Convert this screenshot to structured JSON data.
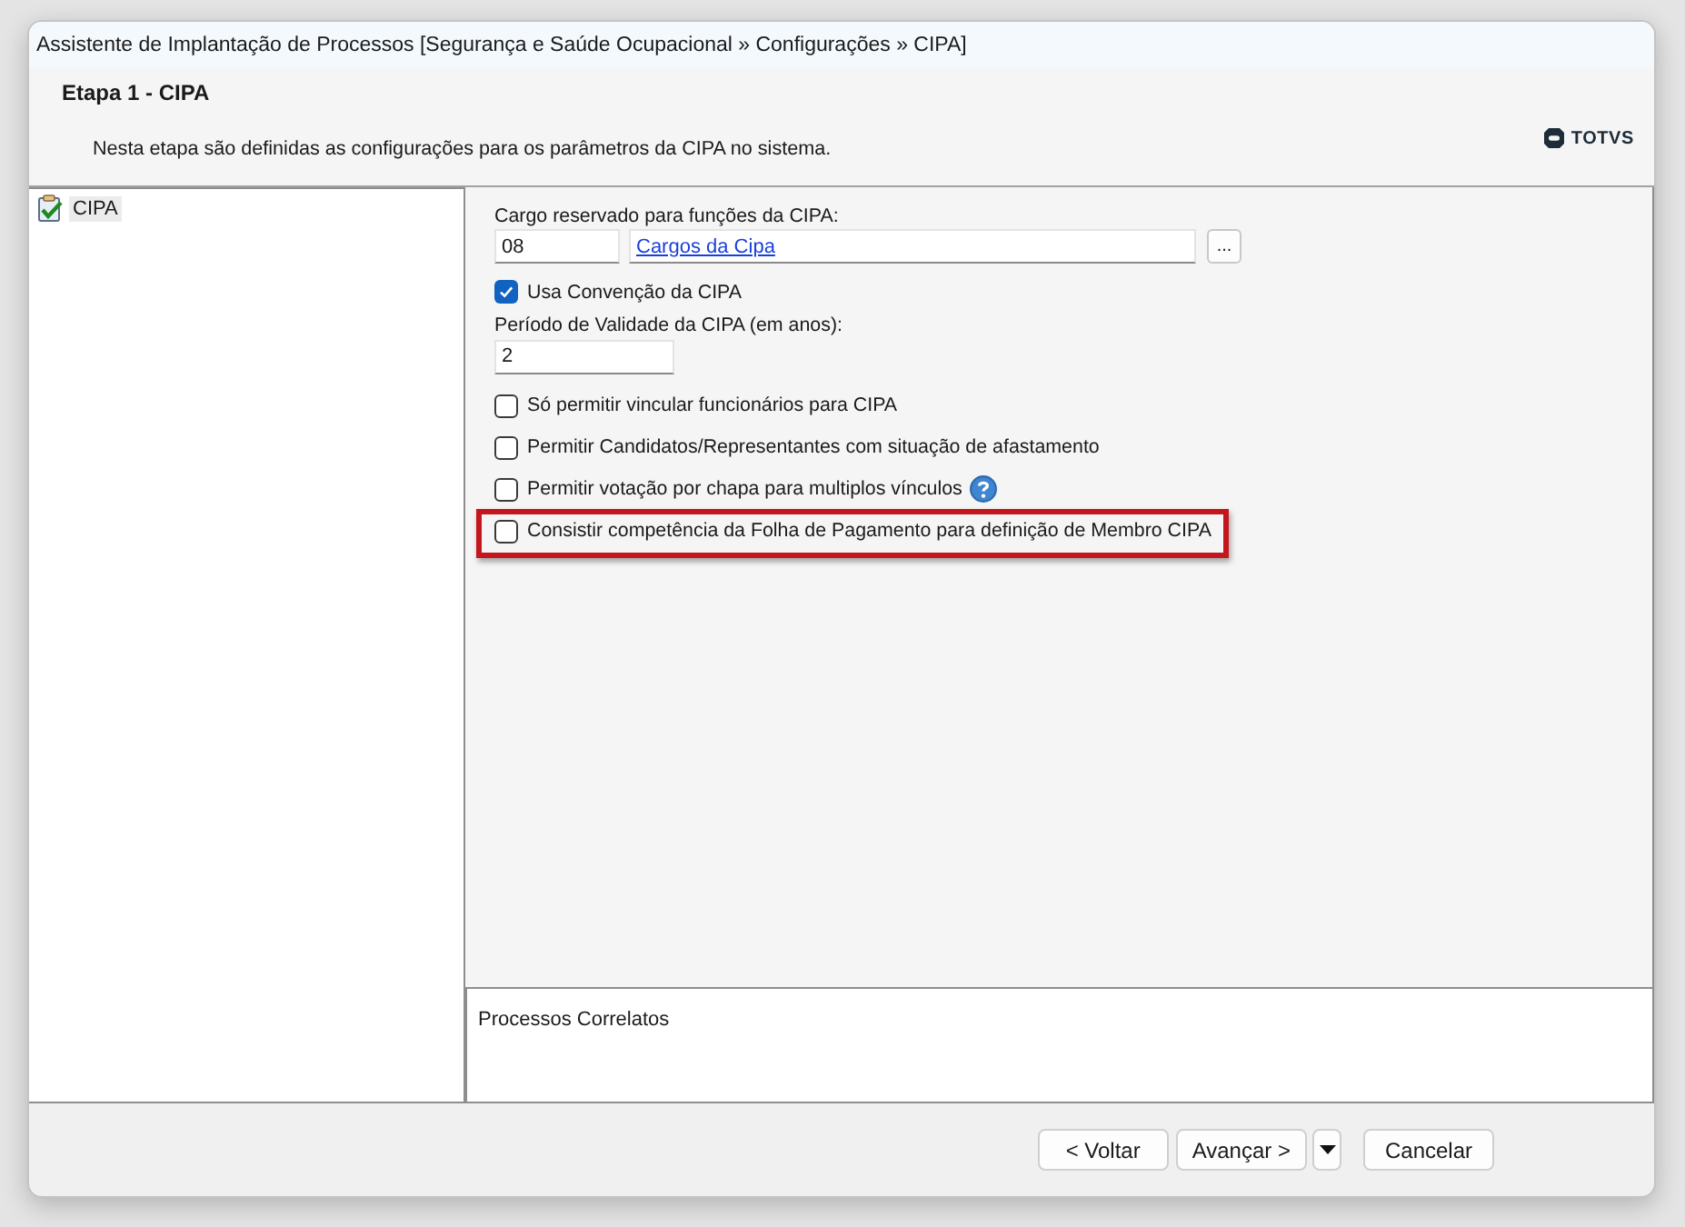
{
  "window": {
    "title": "Assistente de Implantação de Processos [Segurança e Saúde Ocupacional » Configurações » CIPA]"
  },
  "header": {
    "step_title": "Etapa 1 - CIPA",
    "description": "Nesta etapa são definidas as configurações para os parâmetros da CIPA no sistema.",
    "logo_text": "TOTVS"
  },
  "tree": {
    "items": [
      {
        "label": "CIPA",
        "selected": true
      }
    ]
  },
  "form": {
    "cargo": {
      "label": "Cargo reservado para funções da CIPA:",
      "code": "08",
      "link": "Cargos da Cipa",
      "browse_label": "..."
    },
    "convention": {
      "label": "Usa Convenção da CIPA",
      "checked": true
    },
    "validity": {
      "label": "Período de Validade da CIPA (em anos):",
      "value": "2"
    },
    "options": [
      {
        "label": "Só permitir vincular funcionários para CIPA",
        "checked": false,
        "help": false,
        "highlighted": false
      },
      {
        "label": "Permitir Candidatos/Representantes com situação de afastamento",
        "checked": false,
        "help": false,
        "highlighted": false
      },
      {
        "label": "Permitir votação por chapa para multiplos vínculos",
        "checked": false,
        "help": true,
        "highlighted": false
      },
      {
        "label": "Consistir competência da Folha de Pagamento para definição de Membro CIPA",
        "checked": false,
        "help": false,
        "highlighted": true
      }
    ]
  },
  "related": {
    "title": "Processos Correlatos"
  },
  "buttons": [
    {
      "label": "< Voltar",
      "menu": false
    },
    {
      "label": "Avançar >",
      "menu": true
    },
    {
      "label": "Cancelar",
      "menu": false
    }
  ]
}
